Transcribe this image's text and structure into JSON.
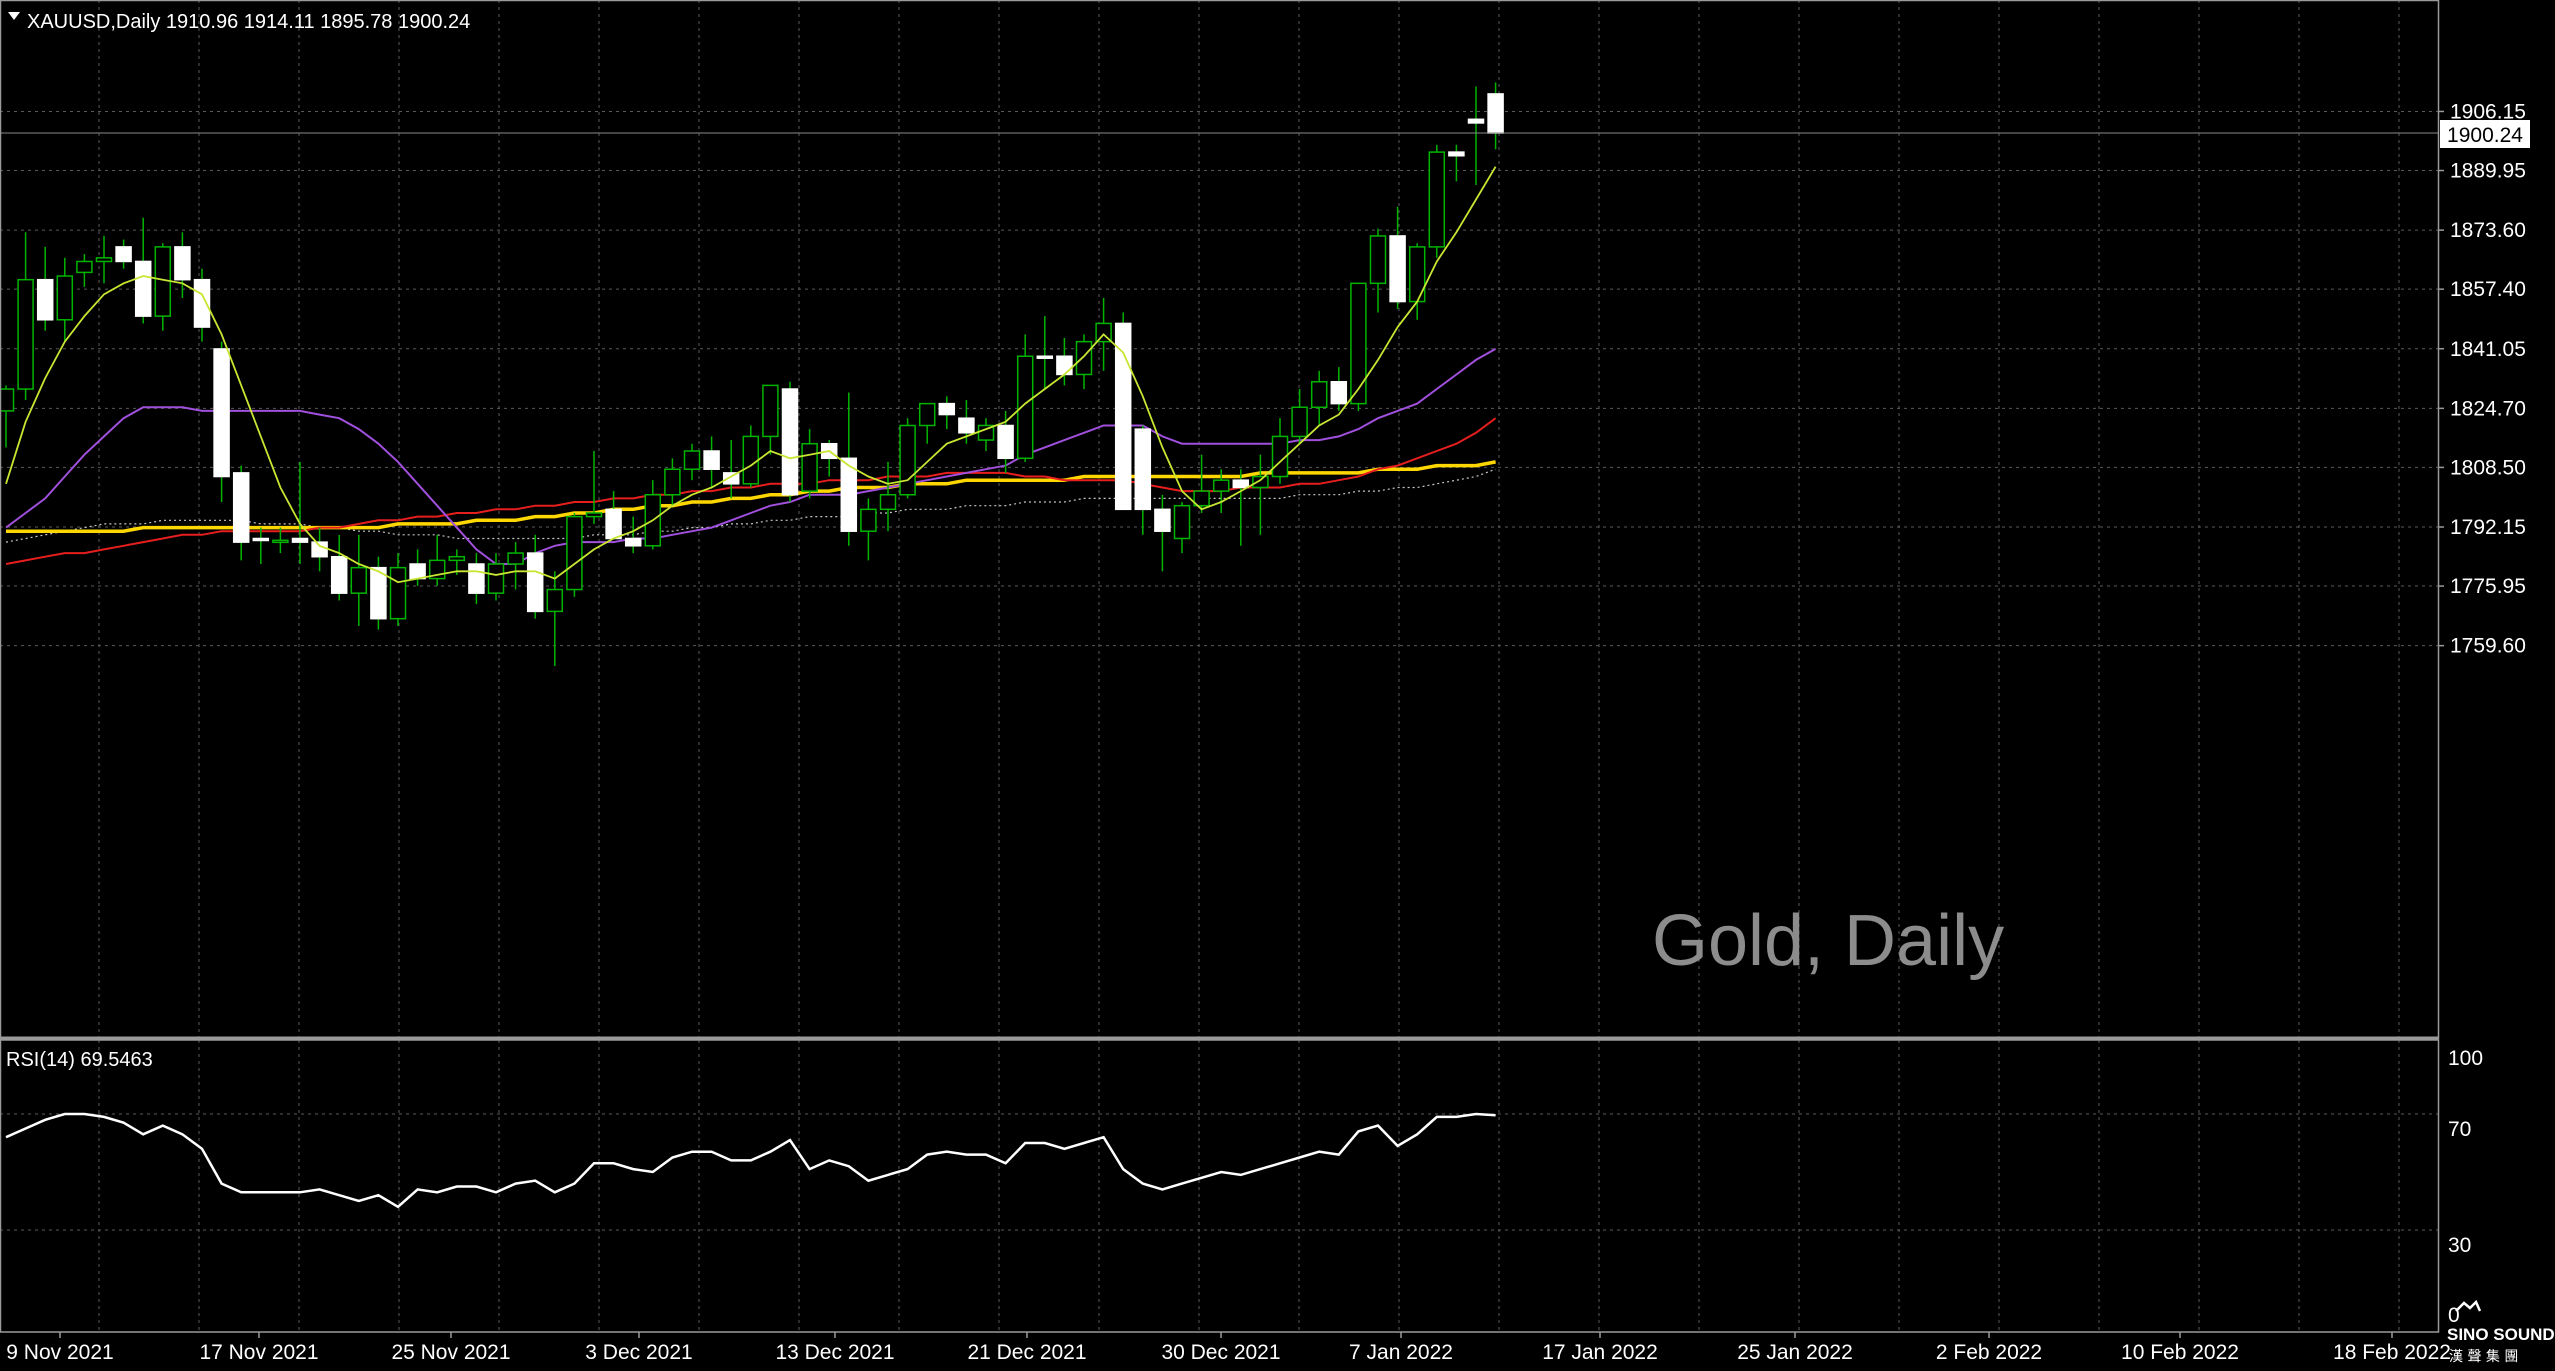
{
  "header": {
    "symbol_line": "XAUUSD,Daily  1910.96 1914.11 1895.78 1900.24",
    "current_price": "1900.24"
  },
  "watermark": "Gold, Daily",
  "rsi_panel": {
    "label": "RSI(14) 69.5463",
    "levels": [
      "100",
      "70",
      "30",
      "0"
    ]
  },
  "logo": {
    "line1": "SINO SOUND",
    "line2": "漢 聲 集 團"
  },
  "colors": {
    "background": "#000000",
    "grid": "#5a5a5a",
    "up_candle": "#000000",
    "down_candle": "#ffffff",
    "wick": "#00b400",
    "ma_fast": "#c8e632",
    "ma_mid": "#a050dc",
    "ma_slow": "#e61e1e",
    "ma_long": "#ffd700",
    "ma_dotted": "#c8c8c8",
    "rsi": "#ffffff"
  },
  "chart_data": [
    {
      "type": "candlestick",
      "title": "XAUUSD,Daily",
      "price_labels": [
        "1906.15",
        "1889.95",
        "1873.60",
        "1857.40",
        "1841.05",
        "1824.70",
        "1808.50",
        "1792.15",
        "1775.95",
        "1759.60"
      ],
      "ylim": [
        1745,
        1915
      ],
      "date_labels": [
        "9 Nov 2021",
        "17 Nov 2021",
        "25 Nov 2021",
        "3 Dec 2021",
        "13 Dec 2021",
        "21 Dec 2021",
        "30 Dec 2021",
        "7 Jan 2022",
        "17 Jan 2022",
        "25 Jan 2022",
        "2 Feb 2022",
        "10 Feb 2022",
        "18 Feb 2022"
      ],
      "last_bar": {
        "open": 1910.96,
        "high": 1914.11,
        "low": 1895.78,
        "close": 1900.24
      },
      "candles": [
        {
          "o": 1824.0,
          "h": 1831.0,
          "l": 1814.0,
          "c": 1830.0
        },
        {
          "o": 1830.0,
          "h": 1873.0,
          "l": 1827.0,
          "c": 1860.0
        },
        {
          "o": 1860.0,
          "h": 1869.0,
          "l": 1846.0,
          "c": 1849.0
        },
        {
          "o": 1849.0,
          "h": 1866.0,
          "l": 1843.0,
          "c": 1861.0
        },
        {
          "o": 1862.0,
          "h": 1867.0,
          "l": 1858.0,
          "c": 1865.0
        },
        {
          "o": 1865.0,
          "h": 1872.0,
          "l": 1859.0,
          "c": 1866.0
        },
        {
          "o": 1869.0,
          "h": 1871.0,
          "l": 1863.0,
          "c": 1865.0
        },
        {
          "o": 1865.0,
          "h": 1877.0,
          "l": 1848.0,
          "c": 1850.0
        },
        {
          "o": 1850.0,
          "h": 1870.0,
          "l": 1846.0,
          "c": 1869.0
        },
        {
          "o": 1869.0,
          "h": 1873.0,
          "l": 1855.0,
          "c": 1860.0
        },
        {
          "o": 1860.0,
          "h": 1863.0,
          "l": 1843.0,
          "c": 1847.0
        },
        {
          "o": 1841.0,
          "h": 1843.0,
          "l": 1799.0,
          "c": 1806.0
        },
        {
          "o": 1807.0,
          "h": 1809.0,
          "l": 1783.0,
          "c": 1788.0
        },
        {
          "o": 1789.0,
          "h": 1792.0,
          "l": 1782.0,
          "c": 1788.5
        },
        {
          "o": 1788.5,
          "h": 1792.0,
          "l": 1785.0,
          "c": 1788.5
        },
        {
          "o": 1789.0,
          "h": 1810.0,
          "l": 1782.0,
          "c": 1788.0
        },
        {
          "o": 1788.0,
          "h": 1792.0,
          "l": 1780.0,
          "c": 1784.0
        },
        {
          "o": 1784.0,
          "h": 1790.0,
          "l": 1772.0,
          "c": 1774.0
        },
        {
          "o": 1774.0,
          "h": 1790.0,
          "l": 1765.0,
          "c": 1781.0
        },
        {
          "o": 1781.0,
          "h": 1784.0,
          "l": 1764.0,
          "c": 1767.0
        },
        {
          "o": 1767.0,
          "h": 1785.0,
          "l": 1765.0,
          "c": 1781.0
        },
        {
          "o": 1782.0,
          "h": 1786.0,
          "l": 1776.0,
          "c": 1778.0
        },
        {
          "o": 1778.0,
          "h": 1790.0,
          "l": 1776.0,
          "c": 1783.0
        },
        {
          "o": 1783.0,
          "h": 1786.0,
          "l": 1779.0,
          "c": 1784.0
        },
        {
          "o": 1782.0,
          "h": 1785.0,
          "l": 1771.0,
          "c": 1774.0
        },
        {
          "o": 1774.0,
          "h": 1785.0,
          "l": 1772.0,
          "c": 1782.0
        },
        {
          "o": 1782.0,
          "h": 1788.0,
          "l": 1775.0,
          "c": 1785.0
        },
        {
          "o": 1785.0,
          "h": 1790.0,
          "l": 1767.0,
          "c": 1769.0
        },
        {
          "o": 1769.0,
          "h": 1780.0,
          "l": 1754.0,
          "c": 1775.0
        },
        {
          "o": 1775.0,
          "h": 1796.0,
          "l": 1773.0,
          "c": 1795.0
        },
        {
          "o": 1795.0,
          "h": 1813.0,
          "l": 1793.0,
          "c": 1796.0
        },
        {
          "o": 1797.0,
          "h": 1802.0,
          "l": 1789.0,
          "c": 1789.0
        },
        {
          "o": 1789.0,
          "h": 1795.0,
          "l": 1785.0,
          "c": 1787.0
        },
        {
          "o": 1787.0,
          "h": 1805.0,
          "l": 1786.0,
          "c": 1801.0
        },
        {
          "o": 1801.0,
          "h": 1811.0,
          "l": 1798.0,
          "c": 1808.0
        },
        {
          "o": 1808.0,
          "h": 1815.0,
          "l": 1805.0,
          "c": 1813.0
        },
        {
          "o": 1813.0,
          "h": 1817.0,
          "l": 1803.0,
          "c": 1808.0
        },
        {
          "o": 1807.0,
          "h": 1816.0,
          "l": 1800.0,
          "c": 1804.0
        },
        {
          "o": 1804.0,
          "h": 1820.0,
          "l": 1803.0,
          "c": 1817.0
        },
        {
          "o": 1817.0,
          "h": 1831.0,
          "l": 1812.0,
          "c": 1831.0
        },
        {
          "o": 1830.0,
          "h": 1832.0,
          "l": 1799.0,
          "c": 1801.0
        },
        {
          "o": 1802.0,
          "h": 1819.0,
          "l": 1800.0,
          "c": 1815.0
        },
        {
          "o": 1815.0,
          "h": 1816.0,
          "l": 1806.0,
          "c": 1811.0
        },
        {
          "o": 1811.0,
          "h": 1829.0,
          "l": 1787.0,
          "c": 1791.0
        },
        {
          "o": 1791.0,
          "h": 1800.0,
          "l": 1783.0,
          "c": 1797.0
        },
        {
          "o": 1797.0,
          "h": 1810.0,
          "l": 1791.0,
          "c": 1801.0
        },
        {
          "o": 1801.0,
          "h": 1822.0,
          "l": 1800.0,
          "c": 1820.0
        },
        {
          "o": 1820.0,
          "h": 1826.0,
          "l": 1815.0,
          "c": 1826.0
        },
        {
          "o": 1826.0,
          "h": 1828.0,
          "l": 1819.0,
          "c": 1823.0
        },
        {
          "o": 1822.0,
          "h": 1827.0,
          "l": 1815.0,
          "c": 1818.0
        },
        {
          "o": 1816.0,
          "h": 1822.0,
          "l": 1813.0,
          "c": 1820.0
        },
        {
          "o": 1820.0,
          "h": 1824.0,
          "l": 1807.0,
          "c": 1811.0
        },
        {
          "o": 1811.0,
          "h": 1845.0,
          "l": 1810.0,
          "c": 1839.0
        },
        {
          "o": 1839.0,
          "h": 1850.0,
          "l": 1830.0,
          "c": 1838.5
        },
        {
          "o": 1839.0,
          "h": 1844.0,
          "l": 1831.0,
          "c": 1834.0
        },
        {
          "o": 1834.0,
          "h": 1845.0,
          "l": 1830.0,
          "c": 1843.0
        },
        {
          "o": 1843.0,
          "h": 1855.0,
          "l": 1835.0,
          "c": 1848.0
        },
        {
          "o": 1848.0,
          "h": 1851.0,
          "l": 1802.0,
          "c": 1797.0
        },
        {
          "o": 1819.0,
          "h": 1820.0,
          "l": 1790.0,
          "c": 1797.0
        },
        {
          "o": 1797.0,
          "h": 1801.0,
          "l": 1780.0,
          "c": 1791.0
        },
        {
          "o": 1789.0,
          "h": 1799.0,
          "l": 1785.0,
          "c": 1798.0
        },
        {
          "o": 1798.0,
          "h": 1812.0,
          "l": 1796.0,
          "c": 1802.0
        },
        {
          "o": 1802.0,
          "h": 1808.0,
          "l": 1796.0,
          "c": 1805.0
        },
        {
          "o": 1805.0,
          "h": 1808.0,
          "l": 1787.0,
          "c": 1803.0
        },
        {
          "o": 1803.0,
          "h": 1812.0,
          "l": 1790.0,
          "c": 1806.0
        },
        {
          "o": 1806.0,
          "h": 1822.0,
          "l": 1804.0,
          "c": 1817.0
        },
        {
          "o": 1817.0,
          "h": 1830.0,
          "l": 1815.0,
          "c": 1825.0
        },
        {
          "o": 1825.0,
          "h": 1835.0,
          "l": 1820.0,
          "c": 1832.0
        },
        {
          "o": 1832.0,
          "h": 1836.0,
          "l": 1824.0,
          "c": 1826.0
        },
        {
          "o": 1826.0,
          "h": 1859.0,
          "l": 1824.0,
          "c": 1859.0
        },
        {
          "o": 1859.0,
          "h": 1874.0,
          "l": 1851.0,
          "c": 1872.0
        },
        {
          "o": 1872.0,
          "h": 1880.0,
          "l": 1852.0,
          "c": 1854.0
        },
        {
          "o": 1854.0,
          "h": 1870.0,
          "l": 1849.0,
          "c": 1869.0
        },
        {
          "o": 1869.0,
          "h": 1897.0,
          "l": 1866.0,
          "c": 1895.0
        },
        {
          "o": 1895.0,
          "h": 1897.0,
          "l": 1887.0,
          "c": 1894.0
        },
        {
          "o": 1904.0,
          "h": 1913.0,
          "l": 1886.0,
          "c": 1903.0
        },
        {
          "o": 1910.96,
          "h": 1914.11,
          "l": 1895.78,
          "c": 1900.24
        }
      ],
      "ma_fast": [
        1804,
        1821,
        1833,
        1843,
        1850,
        1856,
        1859,
        1861,
        1860,
        1859,
        1856,
        1845,
        1831,
        1817,
        1803,
        1793,
        1787,
        1785,
        1782,
        1780,
        1777,
        1778,
        1779,
        1780,
        1780,
        1779,
        1780,
        1780,
        1778,
        1782,
        1786,
        1789,
        1791,
        1794,
        1798,
        1801,
        1803,
        1806,
        1809,
        1813,
        1811,
        1812,
        1813,
        1809,
        1806,
        1804,
        1805,
        1810,
        1815,
        1817,
        1819,
        1821,
        1826,
        1830,
        1834,
        1839,
        1845,
        1840,
        1828,
        1814,
        1802,
        1797,
        1799,
        1802,
        1805,
        1810,
        1815,
        1820,
        1823,
        1830,
        1838,
        1847,
        1854,
        1865,
        1873,
        1882,
        1891
      ],
      "ma_mid": [
        1792,
        1796,
        1800,
        1806,
        1812,
        1817,
        1822,
        1825,
        1825,
        1825,
        1824,
        1824,
        1824,
        1824,
        1824,
        1824,
        1823,
        1822,
        1819,
        1815,
        1810,
        1804,
        1798,
        1792,
        1786,
        1782,
        1782,
        1785,
        1787,
        1788,
        1788,
        1788,
        1789,
        1789,
        1790,
        1791,
        1792,
        1794,
        1796,
        1798,
        1799,
        1801,
        1801,
        1801,
        1802,
        1803,
        1804,
        1805,
        1806,
        1807,
        1808,
        1809,
        1812,
        1814,
        1816,
        1818,
        1820,
        1820,
        1820,
        1817,
        1815,
        1815,
        1815,
        1815,
        1815,
        1815,
        1816,
        1816,
        1817,
        1819,
        1822,
        1824,
        1826,
        1830,
        1834,
        1838,
        1841
      ],
      "ma_slow": [
        1782,
        1783,
        1784,
        1785,
        1785,
        1786,
        1787,
        1788,
        1789,
        1790,
        1790,
        1791,
        1791,
        1791,
        1791,
        1791,
        1792,
        1792,
        1793,
        1794,
        1794,
        1795,
        1795,
        1796,
        1796,
        1797,
        1797,
        1798,
        1798,
        1799,
        1799,
        1800,
        1800,
        1801,
        1801,
        1802,
        1802,
        1803,
        1803,
        1804,
        1804,
        1804,
        1805,
        1805,
        1805,
        1806,
        1806,
        1806,
        1807,
        1807,
        1807,
        1807,
        1806,
        1806,
        1805,
        1805,
        1805,
        1805,
        1804,
        1803,
        1802,
        1802,
        1802,
        1803,
        1803,
        1803,
        1804,
        1804,
        1805,
        1806,
        1808,
        1809,
        1811,
        1813,
        1815,
        1818,
        1822
      ],
      "ma_long": [
        1791,
        1791,
        1791,
        1791,
        1791,
        1791,
        1791,
        1792,
        1792,
        1792,
        1792,
        1792,
        1792,
        1792,
        1792,
        1792,
        1792,
        1792,
        1792,
        1792,
        1793,
        1793,
        1793,
        1793,
        1794,
        1794,
        1794,
        1795,
        1795,
        1796,
        1796,
        1797,
        1797,
        1798,
        1798,
        1799,
        1799,
        1800,
        1800,
        1801,
        1801,
        1802,
        1802,
        1803,
        1803,
        1803,
        1804,
        1804,
        1804,
        1805,
        1805,
        1805,
        1805,
        1805,
        1805,
        1806,
        1806,
        1806,
        1806,
        1806,
        1806,
        1806,
        1806,
        1806,
        1807,
        1807,
        1807,
        1807,
        1807,
        1807,
        1808,
        1808,
        1808,
        1809,
        1809,
        1809,
        1810
      ],
      "ma_dotted": [
        1788,
        1789,
        1790,
        1791,
        1792,
        1793,
        1793,
        1793,
        1794,
        1794,
        1794,
        1794,
        1794,
        1793,
        1793,
        1793,
        1792,
        1792,
        1791,
        1791,
        1790,
        1790,
        1790,
        1789,
        1789,
        1789,
        1789,
        1789,
        1789,
        1789,
        1790,
        1790,
        1790,
        1791,
        1791,
        1792,
        1792,
        1793,
        1793,
        1794,
        1794,
        1795,
        1795,
        1795,
        1796,
        1796,
        1797,
        1797,
        1797,
        1798,
        1798,
        1798,
        1799,
        1799,
        1799,
        1800,
        1800,
        1800,
        1800,
        1800,
        1800,
        1800,
        1800,
        1800,
        1800,
        1800,
        1801,
        1801,
        1801,
        1802,
        1802,
        1803,
        1803,
        1804,
        1805,
        1806,
        1808
      ]
    },
    {
      "type": "line",
      "title": "RSI(14) 69.5463",
      "ylim": [
        0,
        100
      ],
      "levels": [
        100,
        70,
        30,
        0
      ],
      "values": [
        62,
        65,
        68,
        70,
        70,
        69,
        67,
        63,
        66,
        63,
        58,
        46,
        43,
        43,
        43,
        43,
        44,
        42,
        40,
        42,
        38,
        44,
        43,
        45,
        45,
        43,
        46,
        47,
        43,
        46,
        53,
        53,
        51,
        50,
        55,
        57,
        57,
        54,
        54,
        57,
        61,
        51,
        54,
        52,
        47,
        49,
        51,
        56,
        57,
        56,
        56,
        53,
        60,
        60,
        58,
        60,
        62,
        51,
        46,
        44,
        46,
        48,
        50,
        49,
        51,
        53,
        55,
        57,
        56,
        64,
        66,
        59,
        63,
        69,
        69,
        70,
        69.5463
      ]
    }
  ]
}
